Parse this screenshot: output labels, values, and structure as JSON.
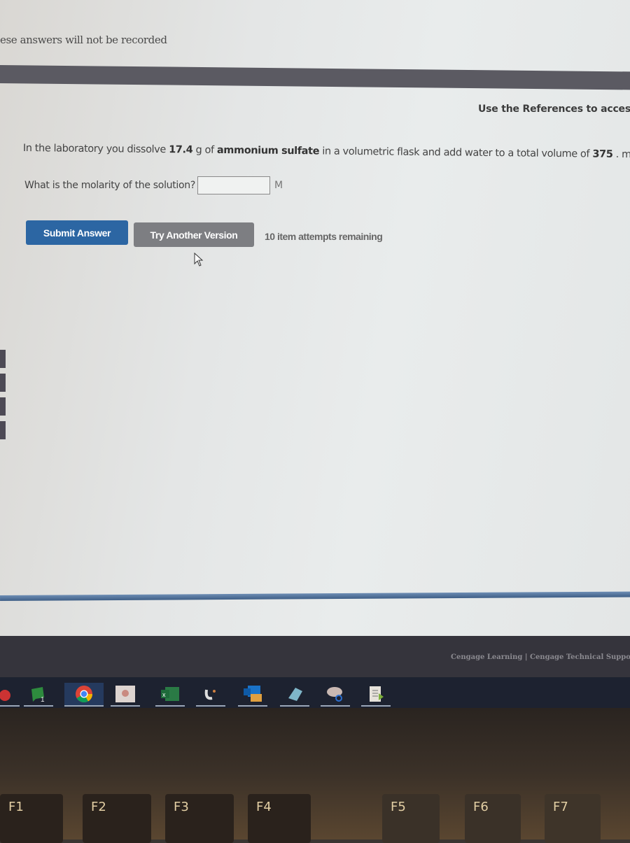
{
  "page": {
    "notice": "ese answers will not be recorded",
    "references_text": "Use the References to access imp"
  },
  "question": {
    "text_before_mass": "In the laboratory you dissolve ",
    "mass": "17.4",
    "text_mass_unit": " g of ",
    "compound": "ammonium sulfate",
    "text_after_compound": " in a volumetric flask and add water to a total volume of ",
    "volume": "375",
    "volume_unit": " . mL.",
    "prompt": "What is the molarity of the solution?",
    "answer_value": "",
    "answer_placeholder": "",
    "answer_unit": "M"
  },
  "actions": {
    "submit_label": "Submit Answer",
    "try_another_label": "Try Another Version",
    "attempts_text": "10 item attempts remaining"
  },
  "footer": {
    "brand_link": "Cengage Learning",
    "separator": "|",
    "support_link": "Cengage Technical Suppo"
  },
  "taskbar": {
    "items": [
      {
        "name": "teams-icon",
        "badge": "1"
      },
      {
        "name": "feedback-hub-icon",
        "badge": "1"
      },
      {
        "name": "chrome-icon",
        "active": true
      },
      {
        "name": "people-app-icon"
      },
      {
        "name": "excel-icon"
      },
      {
        "name": "steam-icon"
      },
      {
        "name": "outlook-icon"
      },
      {
        "name": "notepad-icon"
      },
      {
        "name": "paint-icon"
      },
      {
        "name": "document-icon"
      }
    ]
  },
  "keyboard": {
    "keys": [
      "F1",
      "F2",
      "F3",
      "F4",
      "F5",
      "F6",
      "F7"
    ]
  },
  "colors": {
    "submit_button": "#2c66a3",
    "try_button": "#7d7e82",
    "divider_blue": "#4f6f98"
  }
}
